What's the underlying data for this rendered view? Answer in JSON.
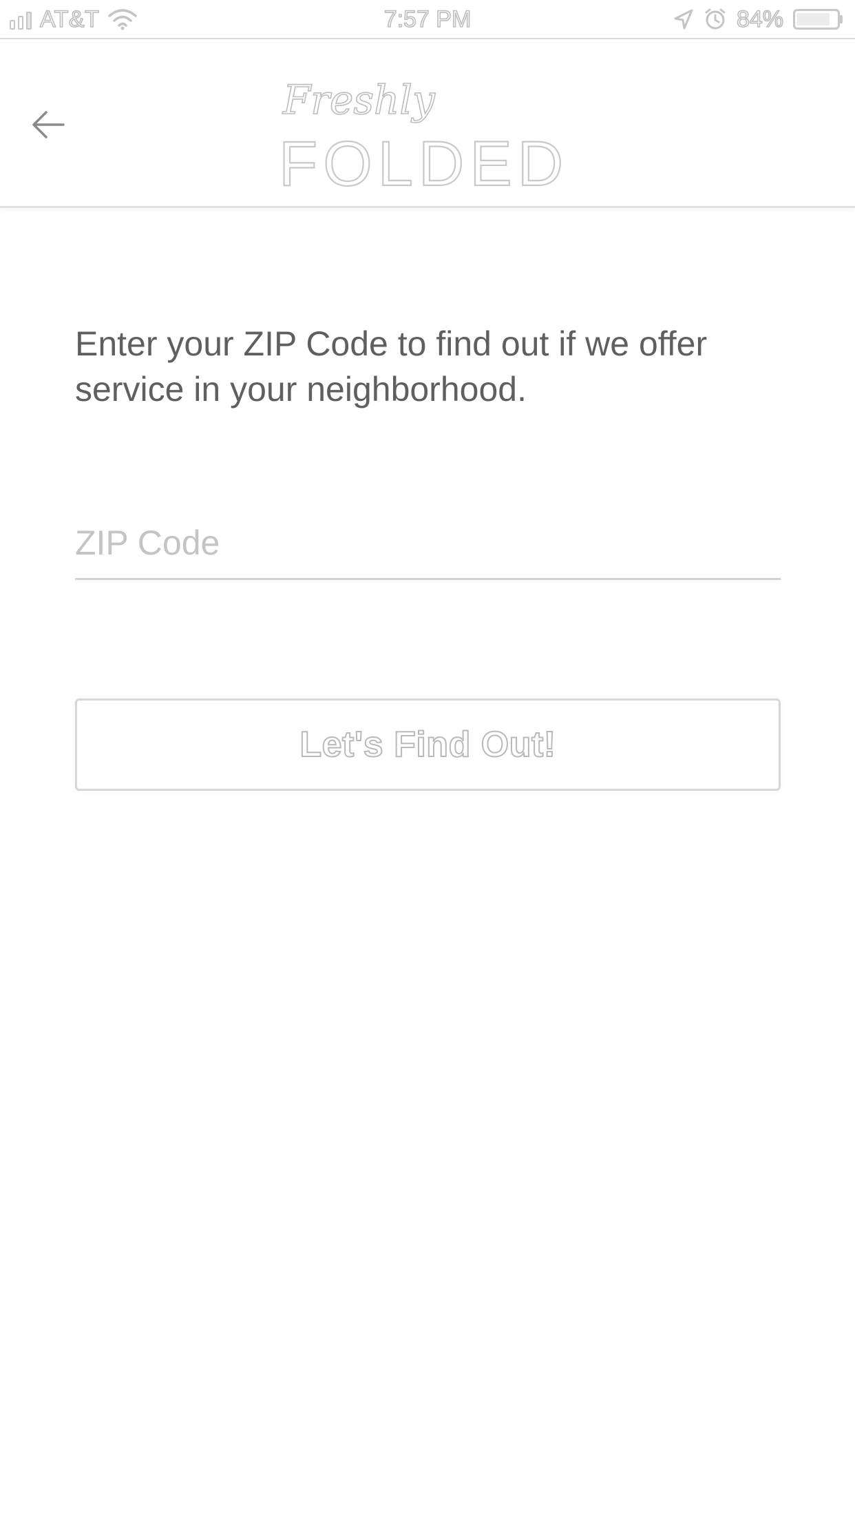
{
  "status_bar": {
    "carrier": "AT&T",
    "time": "7:57 PM",
    "battery_percent": "84%",
    "battery_level": 0.84,
    "icons": [
      "signal-icon",
      "wifi-icon",
      "location-arrow-icon",
      "alarm-icon",
      "battery-icon"
    ]
  },
  "header": {
    "back_icon": "arrow-left-icon",
    "logo": {
      "script_text": "Freshly",
      "block_text": "FOLDED"
    }
  },
  "main": {
    "prompt": "Enter your ZIP Code to find out if we offer service in your neighborhood.",
    "zip_input": {
      "value": "",
      "placeholder": "ZIP Code"
    },
    "submit_label": "Let's Find Out!"
  },
  "colors": {
    "background": "#ffffff",
    "text": "#5f5f5f",
    "placeholder": "#c4c4c4",
    "divider": "#e2e2e2"
  }
}
